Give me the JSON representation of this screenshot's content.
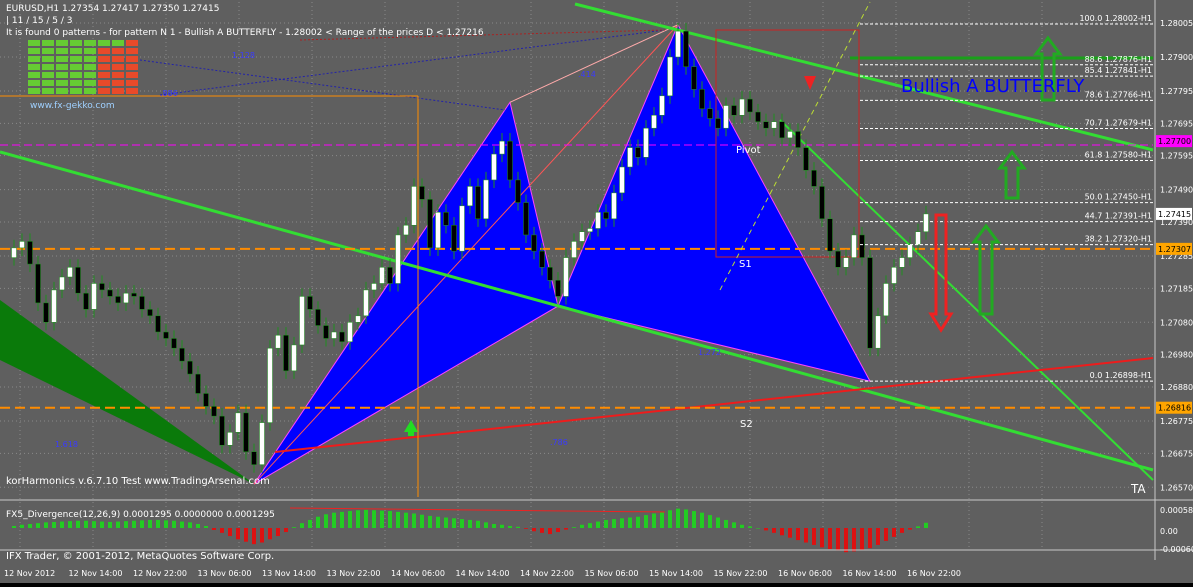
{
  "colors": {
    "background": "#5f5f5f",
    "grid": "#8a8a8a",
    "frame": "#c8c8c8",
    "text": "#ffffff",
    "bull_candle": "#ffffff",
    "bear_candle": "#000000",
    "wick": "#1f8f1f",
    "pattern_fill": "#0000ff",
    "green_line": "#33dd33",
    "red_line": "#ee1c1c",
    "orange_line": "#ff8c00",
    "magenta_line": "#ff00ff",
    "hist_pos": "#22cc22",
    "hist_neg": "#dd1111",
    "price_box_yellow": "#ffa500",
    "price_box_magenta": "#ff00ff",
    "price_box_white": "#ffffff"
  },
  "header": {
    "symbol_line": "EURUSD,H1  1.27354 1.27417 1.27350 1.27415",
    "counts_line": "| 11 / 15 / 5 / 3",
    "pattern_line": "It is found 0 patterns  - for pattern N 1 - Bullish A BUTTERFLY - 1.28002 < Range of the prices D < 1.27216",
    "website": "www.fx-gekko.com"
  },
  "pattern_label": "Bullish A BUTTERFLY",
  "footer_labels": {
    "version": "korHarmonics v.6.7.10 Test www.TradingArsenal.com",
    "copyright": "IFX Trader, © 2001-2012, MetaQuotes Software Corp."
  },
  "indicator": {
    "label": "FX5_Divergence(12,26,9) 0.0001295 0.0000000 0.0001295",
    "axis": [
      "0.00058",
      "0.00",
      "-0.00060"
    ]
  },
  "annotations": {
    "pivot": "Pivot",
    "s1": "S1",
    "s2": "S2",
    "ta": "TA",
    "ratio_1": "1.128",
    "ratio_2": ".414",
    "ratio_3": ".886",
    "ratio_4": "1.618",
    "ratio_5": ".786",
    "ratio_6": "1.272"
  },
  "chart_data": {
    "type": "candlestick",
    "symbol": "EURUSD",
    "timeframe": "H1",
    "price_axis": {
      "labels": [
        "1.28005",
        "1.27900",
        "1.27795",
        "1.27695",
        "1.27595",
        "1.27490",
        "1.27390",
        "1.27285",
        "1.27185",
        "1.27080",
        "1.26980",
        "1.26880",
        "1.26775",
        "1.26675",
        "1.26570"
      ],
      "range": [
        1.2654,
        1.2807
      ]
    },
    "price_tags": [
      {
        "label": "1.27700",
        "value": 1.2764,
        "style": "magenta"
      },
      {
        "label": "1.27415",
        "value": 1.27415,
        "style": "white"
      },
      {
        "label": "1.27307",
        "value": 1.27307,
        "style": "yellow"
      },
      {
        "label": "1.26816",
        "value": 1.26816,
        "style": "yellow"
      }
    ],
    "time_axis": [
      "12 Nov 2012",
      "12 Nov 14:00",
      "12 Nov 22:00",
      "13 Nov 06:00",
      "13 Nov 14:00",
      "13 Nov 22:00",
      "14 Nov 06:00",
      "14 Nov 14:00",
      "14 Nov 22:00",
      "15 Nov 06:00",
      "15 Nov 14:00",
      "15 Nov 22:00",
      "16 Nov 06:00",
      "16 Nov 14:00",
      "16 Nov 22:00"
    ],
    "fib_levels": [
      {
        "label": "100.0 1.28002-H1",
        "value": 1.28002
      },
      {
        "label": "88.6 1.27876-H1",
        "value": 1.27876
      },
      {
        "label": "85.4 1.27841-H1",
        "value": 1.27841
      },
      {
        "label": "78.6 1.27766-H1",
        "value": 1.27766
      },
      {
        "label": "70.7 1.27679-H1",
        "value": 1.27679
      },
      {
        "label": "61.8 1.27580-H1",
        "value": 1.2758
      },
      {
        "label": "50.0 1.27450-H1",
        "value": 1.2745
      },
      {
        "label": "44.7 1.27391-H1",
        "value": 1.27391
      },
      {
        "label": "38.2 1.27320-H1",
        "value": 1.2732
      },
      {
        "label": "0.0 1.26898-H1",
        "value": 1.26898
      }
    ],
    "pattern_points": {
      "X": {
        "bar": 30,
        "price": 1.2658
      },
      "A": {
        "bar": 62,
        "price": 1.2776
      },
      "B": {
        "bar": 68,
        "price": 1.2713
      },
      "C": {
        "bar": 83,
        "price": 1.28
      },
      "D": {
        "bar": 107,
        "price": 1.26898
      }
    },
    "close_prices": [
      1.2731,
      1.2733,
      1.2726,
      1.2714,
      1.2708,
      1.2718,
      1.2722,
      1.2725,
      1.2717,
      1.2712,
      1.272,
      1.2718,
      1.2716,
      1.2714,
      1.2717,
      1.2716,
      1.2712,
      1.271,
      1.2705,
      1.2703,
      1.27,
      1.2696,
      1.2692,
      1.2686,
      1.2682,
      1.2679,
      1.267,
      1.2674,
      1.268,
      1.2668,
      1.2664,
      1.2677,
      1.27,
      1.2704,
      1.2693,
      1.2701,
      1.2716,
      1.2712,
      1.2707,
      1.2703,
      1.2705,
      1.2702,
      1.2708,
      1.271,
      1.2718,
      1.272,
      1.2725,
      1.272,
      1.2735,
      1.2738,
      1.275,
      1.2746,
      1.2731,
      1.2742,
      1.2738,
      1.273,
      1.2744,
      1.275,
      1.274,
      1.2752,
      1.276,
      1.2764,
      1.2752,
      1.2745,
      1.2735,
      1.273,
      1.2725,
      1.2721,
      1.2716,
      1.2728,
      1.2733,
      1.2736,
      1.2737,
      1.2742,
      1.274,
      1.2748,
      1.2756,
      1.2762,
      1.2759,
      1.2768,
      1.2772,
      1.2778,
      1.279,
      1.2798,
      1.2787,
      1.278,
      1.2774,
      1.2771,
      1.2768,
      1.2775,
      1.2772,
      1.2777,
      1.2773,
      1.277,
      1.2768,
      1.277,
      1.2765,
      1.2767,
      1.2762,
      1.2755,
      1.275,
      1.274,
      1.273,
      1.2725,
      1.2728,
      1.2735,
      1.2728,
      1.27,
      1.271,
      1.272,
      1.2725,
      1.2728,
      1.2732,
      1.2736,
      1.27415
    ],
    "macd_hist": [
      5e-05,
      8e-05,
      0.0001,
      0.00012,
      0.00014,
      0.00015,
      0.00016,
      0.00017,
      0.00018,
      0.00018,
      0.00017,
      0.00016,
      0.00015,
      0.00016,
      0.00017,
      0.00018,
      0.00019,
      0.0002,
      0.0002,
      0.00019,
      0.00018,
      0.00016,
      0.00014,
      0.0001,
      5e-05,
      -5e-05,
      -0.00012,
      -0.0002,
      -0.00028,
      -0.00034,
      -0.0004,
      -0.00036,
      -0.00028,
      -0.0002,
      -0.0001,
      2e-05,
      0.00012,
      0.0002,
      0.00028,
      0.00034,
      0.00038,
      0.0004,
      0.00042,
      0.00044,
      0.00045,
      0.00044,
      0.00043,
      0.00042,
      0.0004,
      0.00038,
      0.00036,
      0.00033,
      0.0003,
      0.00028,
      0.00026,
      0.00024,
      0.00022,
      0.0002,
      0.00018,
      0.00014,
      0.0001,
      8e-05,
      5e-05,
      3e-05,
      -2e-05,
      -8e-05,
      -0.00012,
      -0.00015,
      -0.0001,
      -4e-05,
      2e-05,
      8e-05,
      0.00012,
      0.00016,
      0.0002,
      0.00022,
      0.00024,
      0.00026,
      0.00028,
      0.00032,
      0.00036,
      0.0004,
      0.00044,
      0.00048,
      0.00046,
      0.00042,
      0.00038,
      0.00032,
      0.00026,
      0.0002,
      0.00014,
      8e-05,
      4e-05,
      0.0,
      -6e-05,
      -0.00012,
      -0.00018,
      -0.00024,
      -0.0003,
      -0.00036,
      -0.00042,
      -0.00048,
      -0.00052,
      -0.00056,
      -0.0006,
      -0.00058,
      -0.00054,
      -0.0005,
      -0.00042,
      -0.00032,
      -0.00022,
      -0.00012,
      -4e-05,
      4e-05,
      0.0001295
    ]
  }
}
